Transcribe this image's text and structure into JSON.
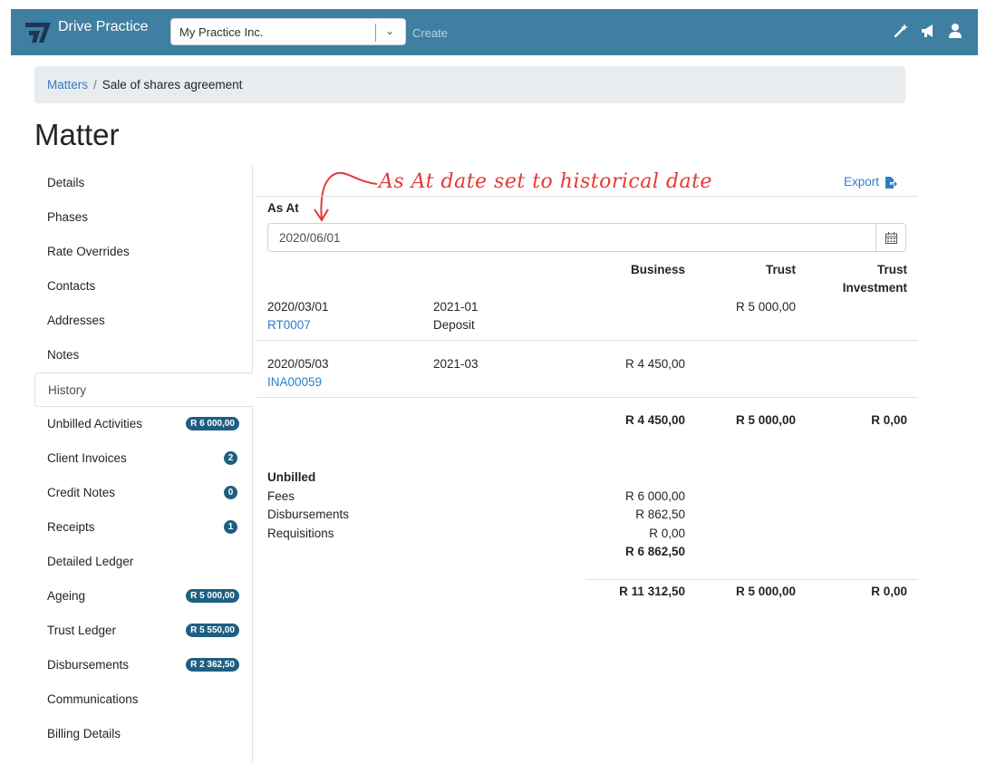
{
  "app": {
    "brand": "Drive Practice",
    "practice_select": "My Practice Inc.",
    "create_label": "Create",
    "colors": {
      "topbar": "#3f7fa2",
      "link": "#2f7cc9",
      "badge": "#1d5f82",
      "annotation": "#e53935"
    },
    "icons": [
      "magic-wand-icon",
      "megaphone-icon",
      "user-icon"
    ]
  },
  "breadcrumb": {
    "parent": "Matters",
    "current": "Sale of shares agreement"
  },
  "page_title": "Matter",
  "sidebar": {
    "items": [
      {
        "label": "Details"
      },
      {
        "label": "Phases"
      },
      {
        "label": "Rate Overrides"
      },
      {
        "label": "Contacts"
      },
      {
        "label": "Addresses"
      },
      {
        "label": "Notes"
      },
      {
        "label": "History",
        "active": true
      },
      {
        "label": "Unbilled Activities",
        "badge": "R 6 000,00"
      },
      {
        "label": "Client Invoices",
        "badge": "2"
      },
      {
        "label": "Credit Notes",
        "badge": "0"
      },
      {
        "label": "Receipts",
        "badge": "1"
      },
      {
        "label": "Detailed Ledger"
      },
      {
        "label": "Ageing",
        "badge": "R 5 000,00"
      },
      {
        "label": "Trust Ledger",
        "badge": "R 5 550,00"
      },
      {
        "label": "Disbursements",
        "badge": "R 2 362,50"
      },
      {
        "label": "Communications"
      },
      {
        "label": "Billing Details"
      }
    ]
  },
  "main": {
    "annotation": "As At date set to historical date",
    "export_label": "Export",
    "as_at_label": "As At",
    "as_at_value": "2020/06/01",
    "columns": {
      "business": "Business",
      "trust": "Trust",
      "trust_investment_1": "Trust",
      "trust_investment_2": "Investment"
    },
    "rows": [
      {
        "date": "2020/03/01",
        "ref": "RT0007",
        "period": "2021-01",
        "desc": "Deposit",
        "business": "",
        "trust": "R 5 000,00",
        "trust_investment": ""
      },
      {
        "date": "2020/05/03",
        "ref": "INA00059",
        "period": "2021-03",
        "desc": "",
        "business": "R 4 450,00",
        "trust": "",
        "trust_investment": ""
      }
    ],
    "totals": {
      "business": "R 4 450,00",
      "trust": "R 5 000,00",
      "trust_investment": "R 0,00"
    },
    "unbilled": {
      "heading": "Unbilled",
      "fees_label": "Fees",
      "fees": "R 6 000,00",
      "disb_label": "Disbursements",
      "disb": "R 862,50",
      "req_label": "Requisitions",
      "req": "R 0,00",
      "total": "R 6 862,50"
    },
    "grand_totals": {
      "business": "R 11 312,50",
      "trust": "R 5 000,00",
      "trust_investment": "R 0,00"
    }
  }
}
